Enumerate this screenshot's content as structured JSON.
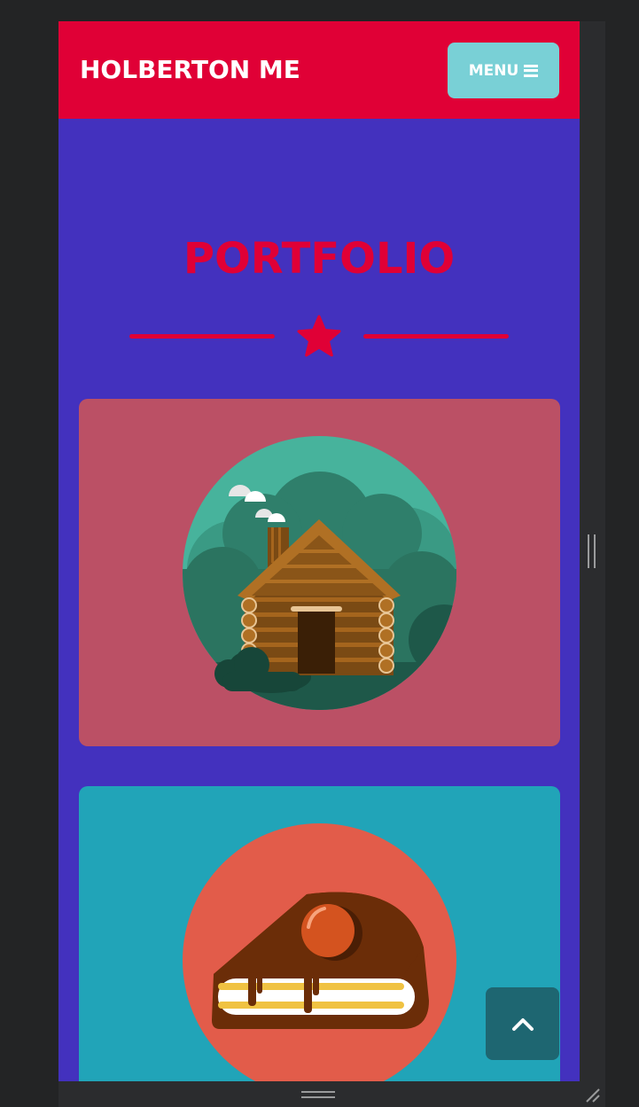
{
  "navbar": {
    "brand": "HOLBERTON ME",
    "menu_label": "MENU",
    "menu_icon": "hamburger-icon",
    "bg": "#e00036"
  },
  "section": {
    "title": "PORTFOLIO",
    "divider_icon": "star-icon",
    "bg": "#4331be",
    "accent": "#e00036"
  },
  "portfolio_items": [
    {
      "icon": "cabin-illustration",
      "bg": "#bb5065"
    },
    {
      "icon": "cake-illustration",
      "bg": "#21a4b8"
    }
  ],
  "back_to_top": {
    "icon": "chevron-up-icon",
    "bg": "#1e6671"
  }
}
